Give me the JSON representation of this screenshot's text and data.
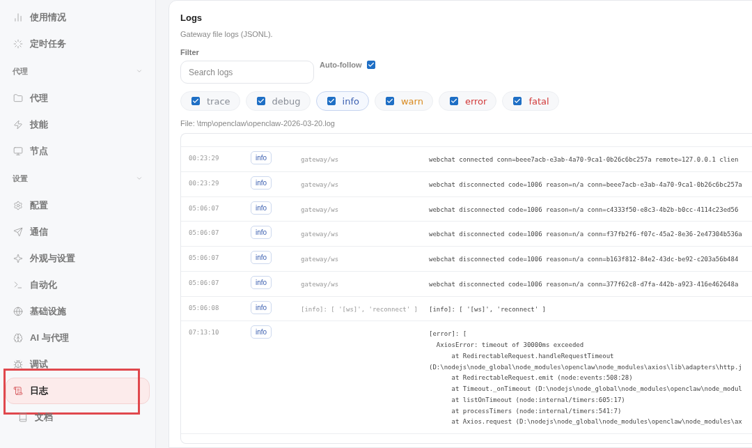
{
  "sidebar": {
    "items": [
      {
        "kind": "item",
        "label": "使用情况",
        "selected": false
      },
      {
        "kind": "item",
        "label": "定时任务",
        "selected": false
      },
      {
        "kind": "group",
        "label": "代理",
        "expanded": true
      },
      {
        "kind": "item",
        "label": "代理",
        "selected": false
      },
      {
        "kind": "item",
        "label": "技能",
        "selected": false
      },
      {
        "kind": "item",
        "label": "节点",
        "selected": false
      },
      {
        "kind": "group",
        "label": "设置",
        "expanded": true
      },
      {
        "kind": "item",
        "label": "配置",
        "selected": false
      },
      {
        "kind": "item",
        "label": "通信",
        "selected": false
      },
      {
        "kind": "item",
        "label": "外观与设置",
        "selected": false
      },
      {
        "kind": "item",
        "label": "自动化",
        "selected": false
      },
      {
        "kind": "item",
        "label": "基础设施",
        "selected": false
      },
      {
        "kind": "item",
        "label": "AI 与代理",
        "selected": false
      },
      {
        "kind": "item",
        "label": "调试",
        "selected": false
      },
      {
        "kind": "item",
        "label": "日志",
        "selected": true,
        "outlined": true
      },
      {
        "kind": "subitem",
        "label": "文档",
        "selected": false
      }
    ]
  },
  "panel": {
    "title": "Logs",
    "subtitle": "Gateway file logs (JSONL).",
    "filter_label": "Filter",
    "search": {
      "placeholder": "Search logs"
    },
    "auto_follow": {
      "label": "Auto-follow",
      "checked": true
    },
    "levels": [
      {
        "label": "trace",
        "checked": true,
        "selected": false,
        "color": "#8a8f98"
      },
      {
        "label": "debug",
        "checked": true,
        "selected": false,
        "color": "#8a8f98"
      },
      {
        "label": "info",
        "checked": true,
        "selected": true,
        "color": "#3b5fb0"
      },
      {
        "label": "warn",
        "checked": true,
        "selected": false,
        "color": "#d98a1f"
      },
      {
        "label": "error",
        "checked": true,
        "selected": false,
        "color": "#d23b3b"
      },
      {
        "label": "fatal",
        "checked": true,
        "selected": false,
        "color": "#d23b3b"
      }
    ],
    "file": "File: \\tmp\\openclaw\\openclaw-2026-03-20.log",
    "rows": [
      {
        "time": "00:23:29",
        "level": "info",
        "subsystem": "gateway/ws",
        "message": [
          "webchat connected conn=beee7acb-e3ab-4a70-9ca1-0b26c6bc257a remote=127.0.0.1 clien"
        ]
      },
      {
        "time": "00:23:29",
        "level": "info",
        "subsystem": "gateway/ws",
        "message": [
          "webchat disconnected code=1006 reason=n/a conn=beee7acb-e3ab-4a70-9ca1-0b26c6bc257a"
        ]
      },
      {
        "time": "05:06:07",
        "level": "info",
        "subsystem": "gateway/ws",
        "message": [
          "webchat disconnected code=1006 reason=n/a conn=c4333f50-e8c3-4b2b-b0cc-4114c23ed56"
        ]
      },
      {
        "time": "05:06:07",
        "level": "info",
        "subsystem": "gateway/ws",
        "message": [
          "webchat disconnected code=1006 reason=n/a conn=f37fb2f6-f07c-45a2-8e36-2e47304b536a"
        ]
      },
      {
        "time": "05:06:07",
        "level": "info",
        "subsystem": "gateway/ws",
        "message": [
          "webchat disconnected code=1006 reason=n/a conn=b163f812-84e2-43dc-be92-c203a56b484"
        ]
      },
      {
        "time": "05:06:07",
        "level": "info",
        "subsystem": "gateway/ws",
        "message": [
          "webchat disconnected code=1006 reason=n/a conn=377f62c8-d7fa-442b-a923-416e462648a"
        ]
      },
      {
        "time": "05:06:08",
        "level": "info",
        "subsystem": "[info]: [ '[ws]', 'reconnect' ]",
        "message": [
          "[info]: [ '[ws]', 'reconnect' ]"
        ]
      },
      {
        "time": "07:13:10",
        "level": "info",
        "message": [
          "[error]: [",
          "  AxiosError: timeout of 30000ms exceeded",
          "      at RedirectableRequest.handleRequestTimeout",
          "(D:\\nodejs\\node_global\\node_modules\\openclaw\\node_modules\\axios\\lib\\adapters\\http.j",
          "      at RedirectableRequest.emit (node:events:508:28)",
          "      at Timeout._onTimeout (D:\\nodejs\\node_global\\node_modules\\openclaw\\node_modul",
          "      at listOnTimeout (node:internal/timers:605:17)",
          "      at processTimers (node:internal/timers:541:7)",
          "      at Axios.request (D:\\nodejs\\node_global\\node_modules\\openclaw\\node_modules\\ax"
        ]
      }
    ]
  }
}
